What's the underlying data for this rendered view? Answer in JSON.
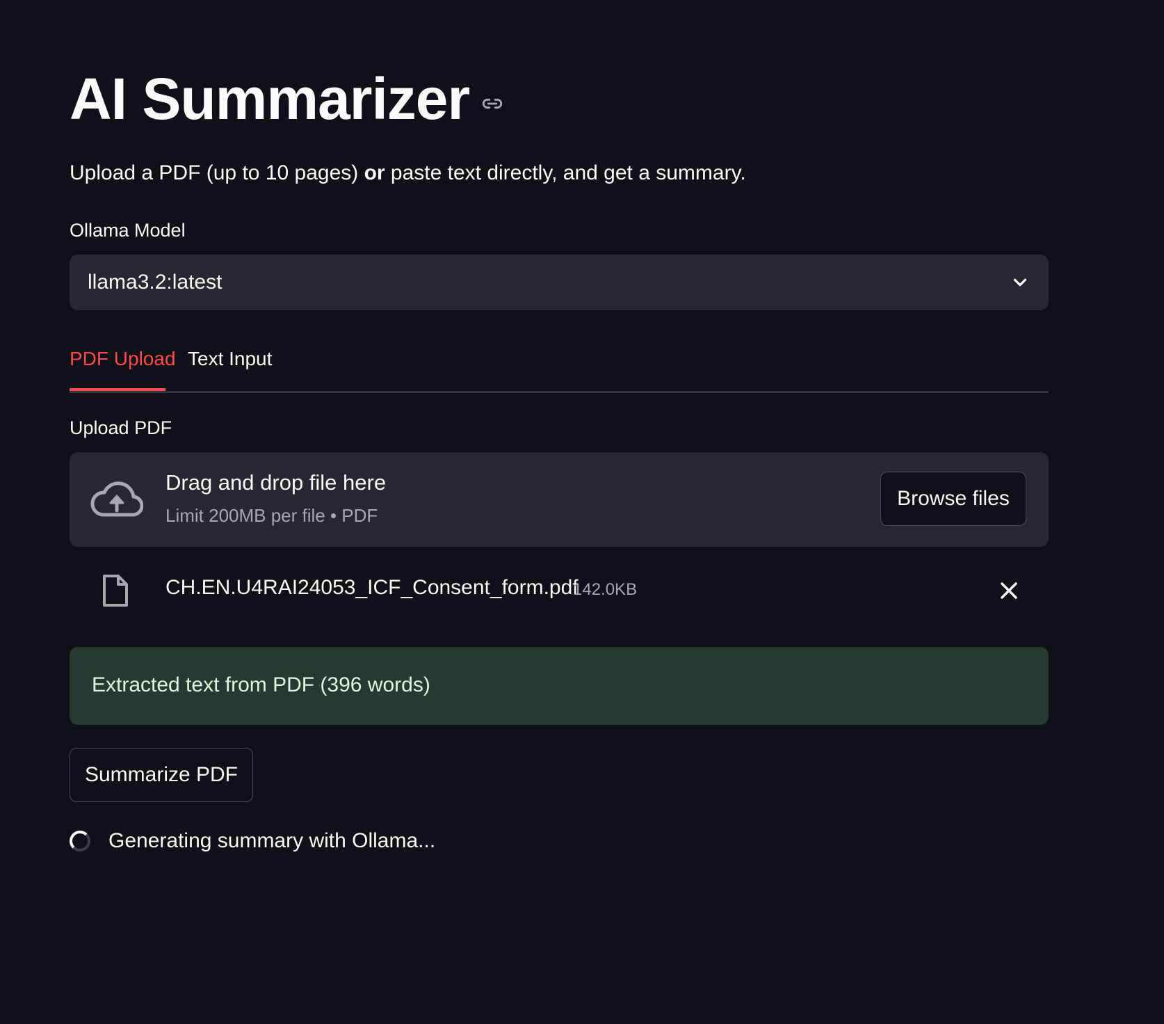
{
  "app": {
    "title": "AI Summarizer",
    "subtitle_part1": "Upload a PDF (up to 10 pages) ",
    "subtitle_bold": "or",
    "subtitle_part2": " paste text directly, and get a summary."
  },
  "model_select": {
    "label": "Ollama Model",
    "value": "llama3.2:latest"
  },
  "tabs": [
    {
      "label": "PDF Upload",
      "active": true
    },
    {
      "label": "Text Input",
      "active": false
    }
  ],
  "uploader": {
    "label": "Upload PDF",
    "drop_title": "Drag and drop file here",
    "drop_subtitle": "Limit 200MB per file • PDF",
    "browse_label": "Browse files",
    "icon": "cloud-upload-icon"
  },
  "file": {
    "name": "CH.EN.U4RAI24053_ICF_Consent_form.pdf",
    "size": "142.0KB",
    "icon": "file-icon"
  },
  "status": {
    "success_message": "Extracted text from PDF (396 words)",
    "summarize_label": "Summarize PDF",
    "spinner_text": "Generating summary with Ollama..."
  },
  "colors": {
    "background": "#0e1117",
    "accent": "#ff4b4b",
    "input_bg": "#262730",
    "success_bg": "#263a2d"
  }
}
